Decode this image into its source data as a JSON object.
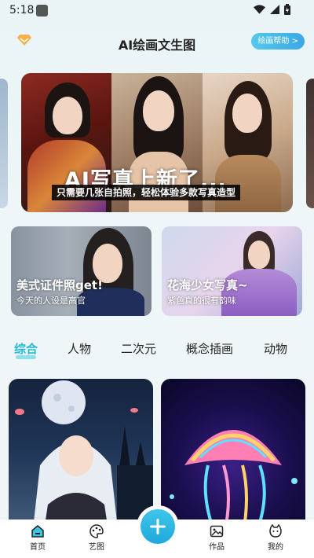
{
  "status_bar": {
    "time": "5:18"
  },
  "header": {
    "title": "AI绘画文生图",
    "help_button": "绘画帮助 >"
  },
  "banner": {
    "title": "AI写真上新了...",
    "subtitle": "只需要几张自拍照，轻松体验多款写真造型"
  },
  "feature_cards": [
    {
      "title": "美式证件照get!",
      "subtitle": "今天的人设是高官"
    },
    {
      "title": "花海少女写真~",
      "subtitle": "紫色真的很有韵味"
    }
  ],
  "tabs": [
    "综合",
    "人物",
    "二次元",
    "概念插画",
    "动物"
  ],
  "active_tab": "综合",
  "bottom_nav": {
    "home": "首页",
    "art": "艺图",
    "works": "作品",
    "mine": "我的"
  },
  "colors": {
    "accent": "#25b8d8",
    "fab": "#1fa8dc"
  }
}
